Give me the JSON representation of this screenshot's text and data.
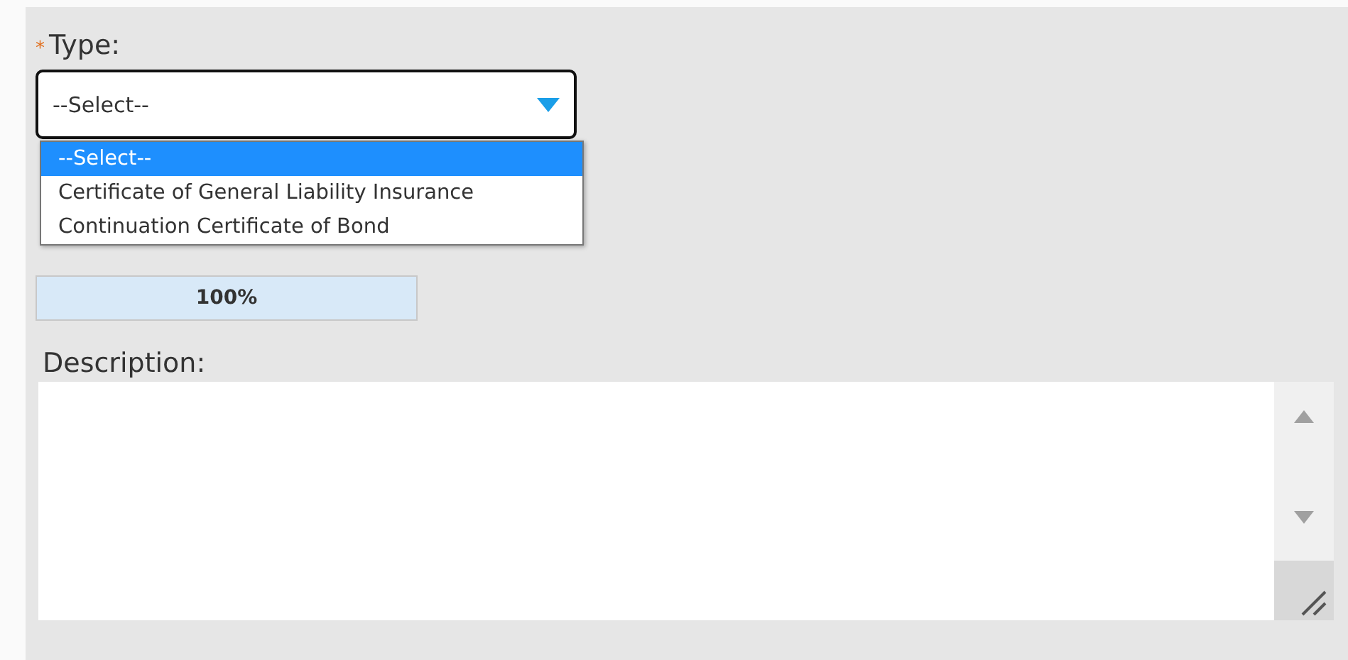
{
  "type_field": {
    "label": "Type:",
    "required_mark": "*",
    "value": "--Select--",
    "expanded": true,
    "options": [
      {
        "label": "--Select--",
        "selected": true
      },
      {
        "label": "Certificate of General Liability Insurance",
        "selected": false
      },
      {
        "label": "Continuation Certificate of Bond",
        "selected": false
      }
    ]
  },
  "upload": {
    "level": 1,
    "reading": "100%"
  },
  "description": {
    "label": "Description:"
  }
}
